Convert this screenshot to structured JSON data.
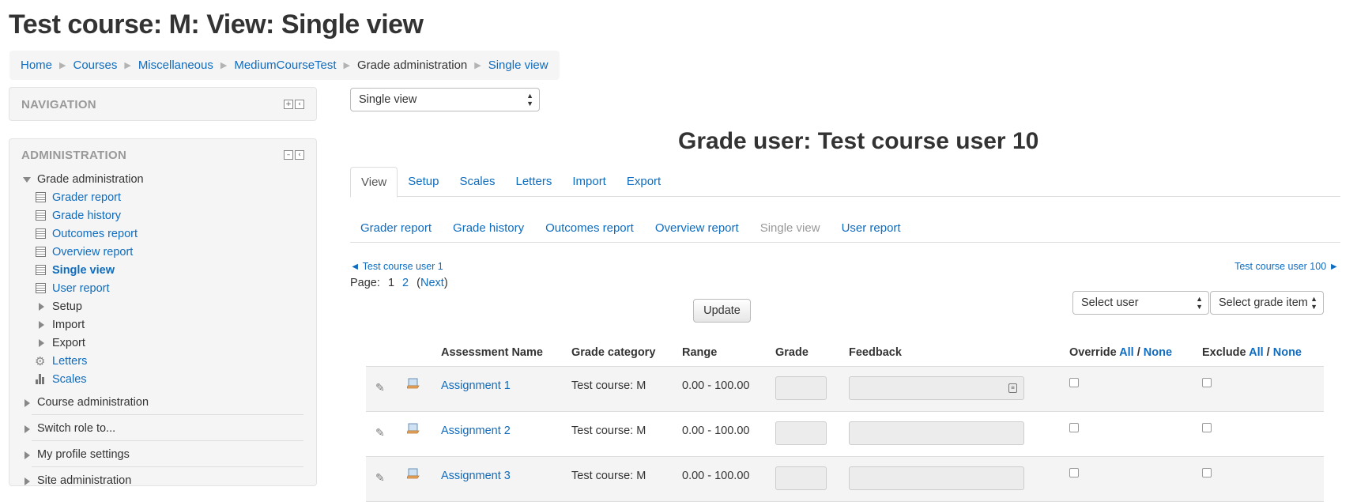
{
  "page": {
    "title": "Test course: M: View: Single view"
  },
  "breadcrumb": [
    {
      "label": "Home",
      "link": true
    },
    {
      "label": "Courses",
      "link": true
    },
    {
      "label": "Miscellaneous",
      "link": true
    },
    {
      "label": "MediumCourseTest",
      "link": true
    },
    {
      "label": "Grade administration",
      "link": false
    },
    {
      "label": "Single view",
      "link": true
    }
  ],
  "navigation": {
    "title": "NAVIGATION"
  },
  "administration": {
    "title": "ADMINISTRATION",
    "grade_admin": "Grade administration",
    "items": {
      "grader_report": "Grader report",
      "grade_history": "Grade history",
      "outcomes_report": "Outcomes report",
      "overview_report": "Overview report",
      "single_view": "Single view",
      "user_report": "User report",
      "setup": "Setup",
      "import": "Import",
      "export": "Export",
      "letters": "Letters",
      "scales": "Scales"
    },
    "course_admin": "Course administration",
    "switch_role": "Switch role to...",
    "profile_settings": "My profile settings",
    "site_admin": "Site administration"
  },
  "view_select": {
    "value": "Single view"
  },
  "heading": "Grade user: Test course user 10",
  "tabs": [
    "View",
    "Setup",
    "Scales",
    "Letters",
    "Import",
    "Export"
  ],
  "subtabs": [
    "Grader report",
    "Grade history",
    "Outcomes report",
    "Overview report",
    "Single view",
    "User report"
  ],
  "prev_user": "◄ Test course user 1",
  "next_user": "Test course user 100 ►",
  "paging": {
    "label": "Page:",
    "current": "1",
    "page2": "2",
    "next": "Next"
  },
  "update_button": "Update",
  "select_user": "Select user",
  "select_grade_item": "Select grade item",
  "table": {
    "headers": {
      "assessment": "Assessment Name",
      "category": "Grade category",
      "range": "Range",
      "grade": "Grade",
      "feedback": "Feedback",
      "override": "Override",
      "exclude": "Exclude",
      "all": "All",
      "slash": "/",
      "none": "None"
    },
    "rows": [
      {
        "name": "Assignment 1",
        "category": "Test course: M",
        "range": "0.00 - 100.00"
      },
      {
        "name": "Assignment 2",
        "category": "Test course: M",
        "range": "0.00 - 100.00"
      },
      {
        "name": "Assignment 3",
        "category": "Test course: M",
        "range": "0.00 - 100.00"
      }
    ]
  },
  "colors": {
    "link": "#0f6cbf",
    "text": "#333333",
    "muted": "#999999",
    "block_bg": "#f5f5f5"
  }
}
